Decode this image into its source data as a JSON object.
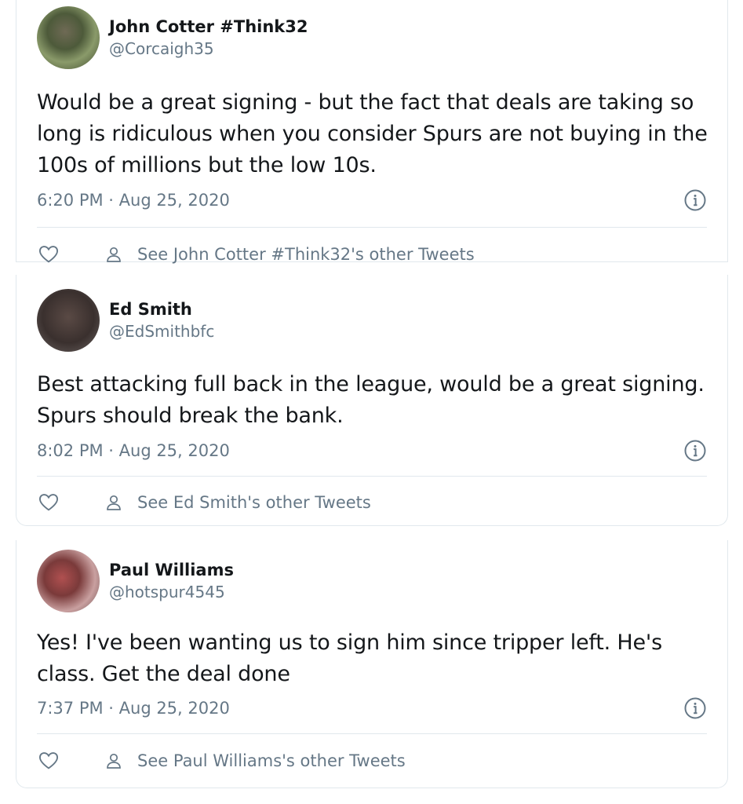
{
  "tweets": [
    {
      "display_name": "John Cotter #Think32",
      "handle": "@Corcaigh35",
      "text": "Would be a great signing - but the fact that deals are taking so long is ridiculous when you consider Spurs are not buying in the 100s of millions but the low 10s.",
      "time": "6:20 PM · Aug 25, 2020",
      "other_tweets": "See John Cotter #Think32's other Tweets"
    },
    {
      "display_name": "Ed Smith",
      "handle": "@EdSmithbfc",
      "text": "Best attacking full back in the league, would be a great signing. Spurs should break the bank.",
      "time": "8:02 PM · Aug 25, 2020",
      "other_tweets": "See Ed Smith's other Tweets"
    },
    {
      "display_name": "Paul Williams",
      "handle": "@hotspur4545",
      "text": "Yes! I've been wanting us to sign him since tripper left. He's class. Get the deal done",
      "time": "7:37 PM · Aug 25, 2020",
      "other_tweets": "See Paul Williams's other Tweets"
    }
  ],
  "icons": {
    "like": "heart-outline-icon",
    "profile": "person-icon",
    "info": "info-circle-icon"
  },
  "colors": {
    "text": "#14171a",
    "secondary": "#657786",
    "border": "#e1e8ed"
  }
}
